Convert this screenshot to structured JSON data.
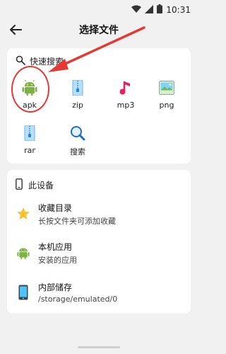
{
  "status": {
    "time": "10:31"
  },
  "appbar": {
    "title": "选择文件"
  },
  "quick": {
    "header": "快速搜索",
    "items": [
      {
        "label": "apk",
        "icon": "android-icon"
      },
      {
        "label": "zip",
        "icon": "zip-icon"
      },
      {
        "label": "mp3",
        "icon": "music-note-icon"
      },
      {
        "label": "png",
        "icon": "image-icon"
      },
      {
        "label": "rar",
        "icon": "rar-icon"
      },
      {
        "label": "搜索",
        "icon": "search-icon"
      }
    ]
  },
  "device": {
    "header": "此设备",
    "rows": [
      {
        "title": "收藏目录",
        "subtitle": "长按文件夹可添加收藏",
        "icon": "star-icon"
      },
      {
        "title": "本机应用",
        "subtitle": "安装的应用",
        "icon": "android-icon"
      },
      {
        "title": "内部储存",
        "subtitle": "/storage/emulated/0",
        "icon": "phone-storage-icon"
      }
    ]
  },
  "colors": {
    "accent_red": "#e53935",
    "android_green": "#7cb342",
    "music_pink": "#e91e63",
    "zip_blue": "#64b5f6",
    "star_yellow": "#fbc02d"
  }
}
